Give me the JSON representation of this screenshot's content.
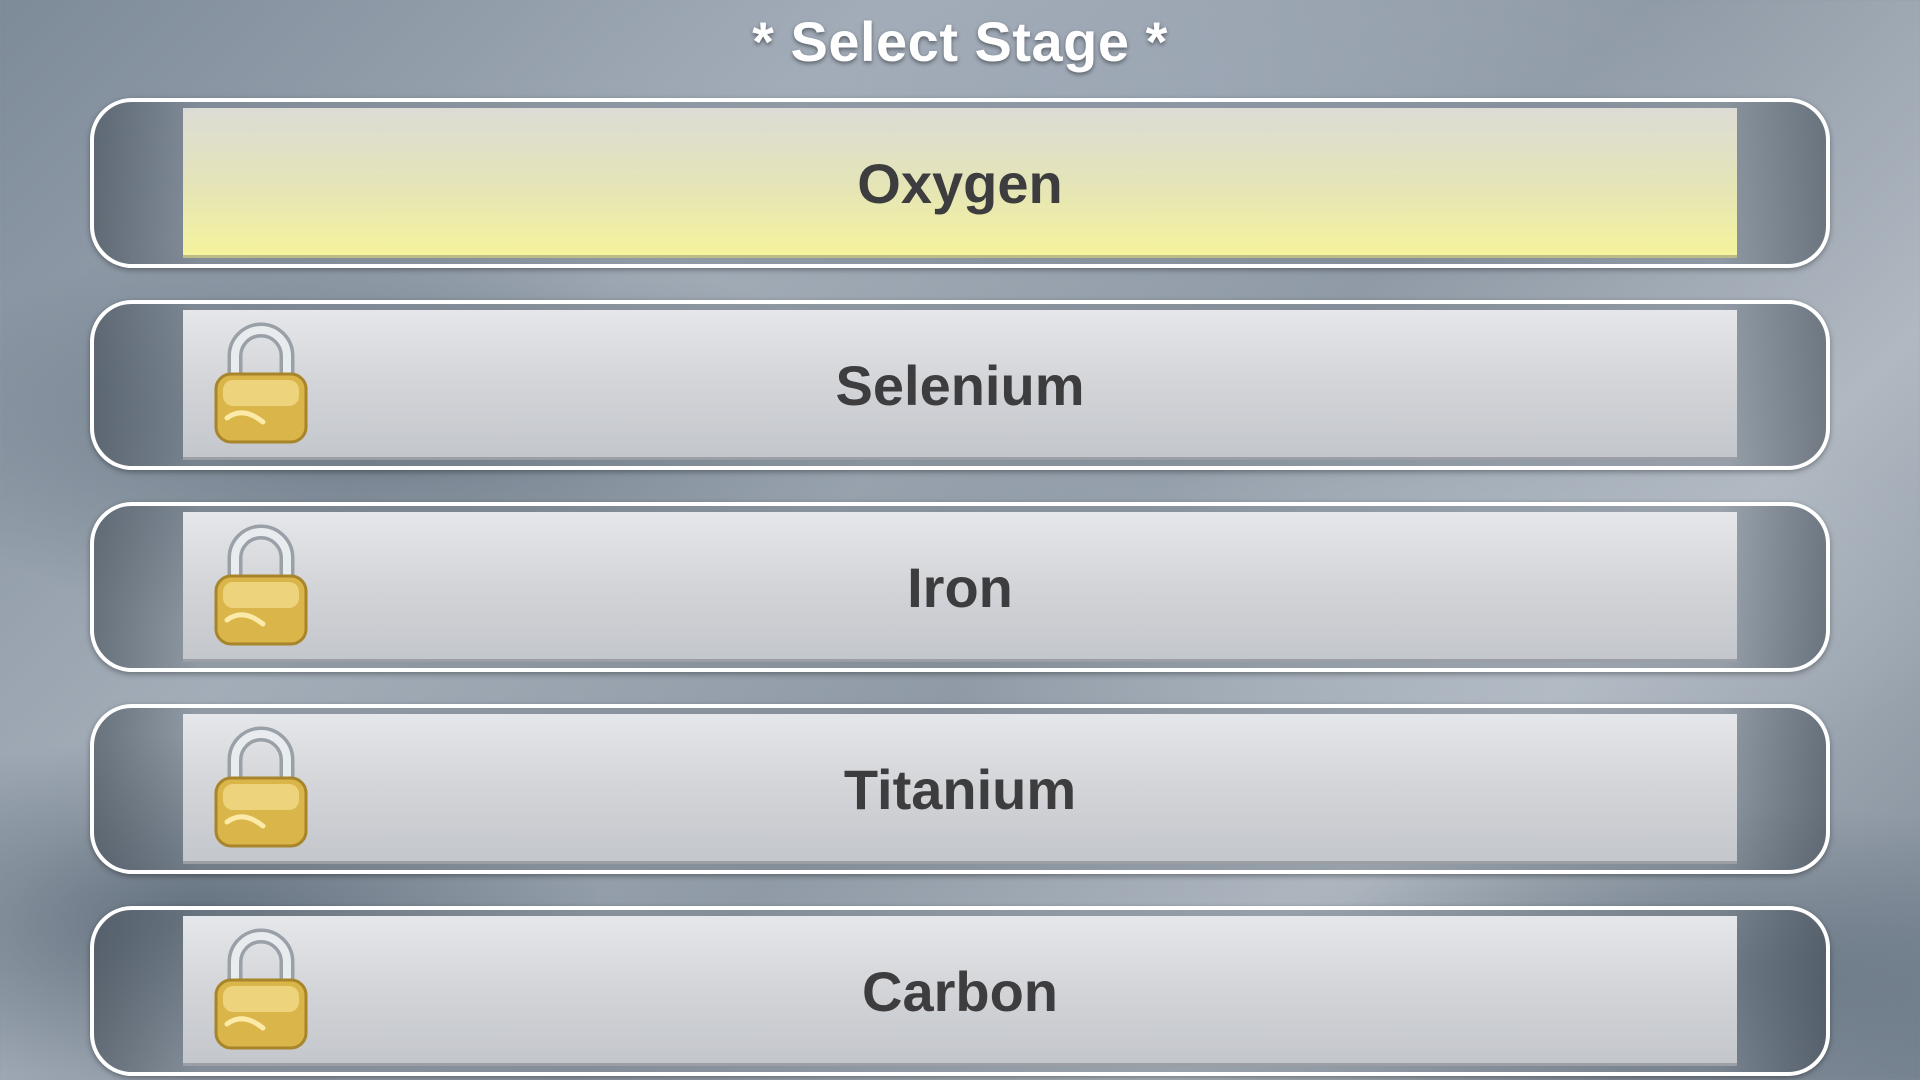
{
  "title": "* Select Stage *",
  "colors": {
    "unlocked_panel": "#f6f49c",
    "locked_panel": "#d2d4d8",
    "label_text": "#3d3d3f",
    "border": "#ffffff",
    "lock_body": "#d9b54a"
  },
  "stages": [
    {
      "label": "Oxygen",
      "locked": false
    },
    {
      "label": "Selenium",
      "locked": true,
      "icon": "padlock-icon"
    },
    {
      "label": "Iron",
      "locked": true,
      "icon": "padlock-icon"
    },
    {
      "label": "Titanium",
      "locked": true,
      "icon": "padlock-icon"
    },
    {
      "label": "Carbon",
      "locked": true,
      "icon": "padlock-icon"
    }
  ]
}
